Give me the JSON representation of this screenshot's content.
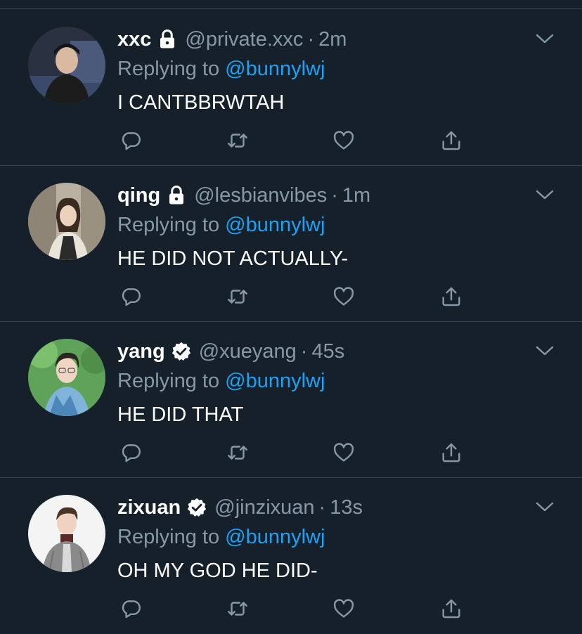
{
  "colors": {
    "background": "#15202b",
    "divider": "#38444d",
    "muted": "#8899a6",
    "accent": "#1da1f2",
    "text": "#ffffff"
  },
  "tweets": [
    {
      "name": "xxc",
      "badge": "lock-icon",
      "handle": "@private.xxc",
      "separator": "·",
      "time": "2m",
      "replying_prefix": "Replying to",
      "replying_to": "@bunnylwj",
      "text": "I CANTBBRWTAH"
    },
    {
      "name": "qing",
      "badge": "lock-icon",
      "handle": "@lesbianvibes",
      "separator": "·",
      "time": "1m",
      "replying_prefix": "Replying to",
      "replying_to": "@bunnylwj",
      "text": "HE DID NOT ACTUALLY-"
    },
    {
      "name": "yang",
      "badge": "verified-icon",
      "handle": "@xueyang",
      "separator": "·",
      "time": "45s",
      "replying_prefix": "Replying to",
      "replying_to": "@bunnylwj",
      "text": "HE DID THAT"
    },
    {
      "name": "zixuan",
      "badge": "verified-icon",
      "handle": "@jinzixuan",
      "separator": "·",
      "time": "13s",
      "replying_prefix": "Replying to",
      "replying_to": "@bunnylwj",
      "text": "OH MY GOD HE DID-"
    }
  ]
}
